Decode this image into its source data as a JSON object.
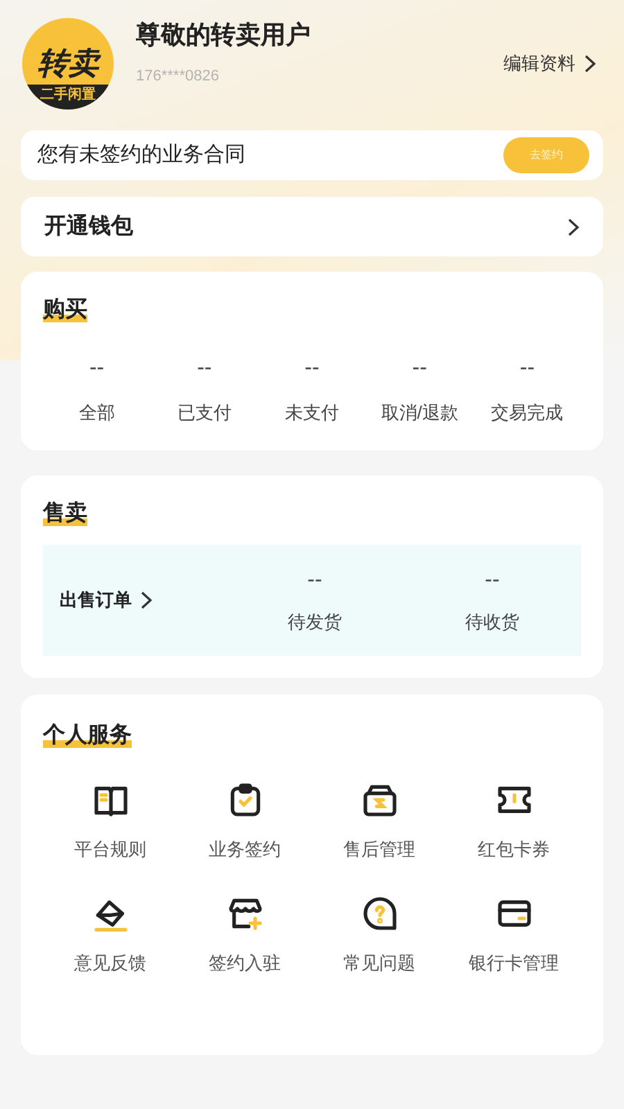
{
  "profile": {
    "logo_top": "转卖",
    "logo_bottom": "二手闲置",
    "name": "尊敬的转卖用户",
    "phone": "176****0826",
    "edit": "编辑资料"
  },
  "contract": {
    "text": "您有未签约的业务合同",
    "button": "去签约"
  },
  "wallet": {
    "label": "开通钱包"
  },
  "buy": {
    "title": "购买",
    "stats": [
      {
        "value": "--",
        "label": "全部"
      },
      {
        "value": "--",
        "label": "已支付"
      },
      {
        "value": "--",
        "label": "未支付"
      },
      {
        "value": "--",
        "label": "取消/退款"
      },
      {
        "value": "--",
        "label": "交易完成"
      }
    ]
  },
  "sell": {
    "title": "售卖",
    "orders": "出售订单",
    "stats": [
      {
        "value": "--",
        "label": "待发货"
      },
      {
        "value": "--",
        "label": "待收货"
      }
    ]
  },
  "services": {
    "title": "个人服务",
    "items": [
      {
        "kind": "book",
        "label": "平台规则"
      },
      {
        "kind": "clipboard",
        "label": "业务签约"
      },
      {
        "kind": "box",
        "label": "售后管理"
      },
      {
        "kind": "ticket",
        "label": "红包卡券"
      },
      {
        "kind": "feedback",
        "label": "意见反馈"
      },
      {
        "kind": "shop",
        "label": "签约入驻"
      },
      {
        "kind": "question",
        "label": "常见问题"
      },
      {
        "kind": "card",
        "label": "银行卡管理"
      }
    ]
  }
}
